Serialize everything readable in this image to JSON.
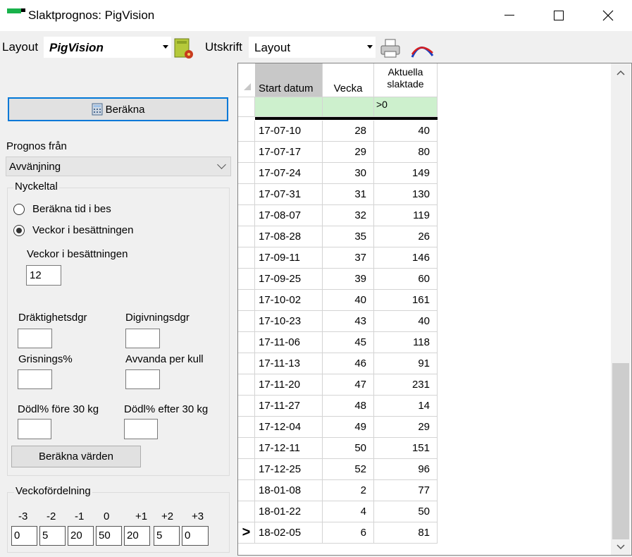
{
  "window": {
    "title": "Slaktprognos: PigVision",
    "minimize": "—",
    "maximize": "☐",
    "close": "✕"
  },
  "toolbar": {
    "layout_label": "Layout",
    "layout_value": "PigVision",
    "print_label": "Utskrift",
    "print_value": "Layout",
    "icons": [
      "layout-settings-icon",
      "printer-icon",
      "curve-chart-icon"
    ]
  },
  "panel": {
    "calc_button": "Beräkna",
    "prognos_label": "Prognos från",
    "prognos_value": "Avvänjning",
    "nyckeltal": {
      "legend": "Nyckeltal",
      "radio_calc": "Beräkna tid i bes",
      "radio_weeks": "Veckor i besättningen",
      "weeks_label": "Veckor i besättningen",
      "weeks_value": "12",
      "drakt_label": "Dräktighetsdgr",
      "digiv_label": "Digivningsdgr",
      "grisning_label": "Grisnings%",
      "avvanda_label": "Avvanda per kull",
      "dod_fore_label": "Dödl% före 30 kg",
      "dod_efter_label": "Dödl% efter 30 kg",
      "calc_values_button": "Beräkna värden"
    },
    "veckofordelning": {
      "legend": "Veckofördelning",
      "offsets": [
        "-3",
        "-2",
        "-1",
        "0",
        "+1",
        "+2",
        "+3"
      ],
      "values": [
        "0",
        "5",
        "20",
        "50",
        "20",
        "5",
        "0"
      ]
    }
  },
  "grid": {
    "headers": [
      "Start datum",
      "Vecka",
      "Aktuella slaktade"
    ],
    "filter": [
      "",
      "",
      ">0"
    ],
    "current_row_marker": ">",
    "rows": [
      [
        "17-07-10",
        "28",
        "40"
      ],
      [
        "17-07-17",
        "29",
        "80"
      ],
      [
        "17-07-24",
        "30",
        "149"
      ],
      [
        "17-07-31",
        "31",
        "130"
      ],
      [
        "17-08-07",
        "32",
        "119"
      ],
      [
        "17-08-28",
        "35",
        "26"
      ],
      [
        "17-09-11",
        "37",
        "146"
      ],
      [
        "17-09-25",
        "39",
        "60"
      ],
      [
        "17-10-02",
        "40",
        "161"
      ],
      [
        "17-10-23",
        "43",
        "40"
      ],
      [
        "17-11-06",
        "45",
        "118"
      ],
      [
        "17-11-13",
        "46",
        "91"
      ],
      [
        "17-11-20",
        "47",
        "231"
      ],
      [
        "17-11-27",
        "48",
        "14"
      ],
      [
        "17-12-04",
        "49",
        "29"
      ],
      [
        "17-12-11",
        "50",
        "151"
      ],
      [
        "17-12-25",
        "52",
        "96"
      ],
      [
        "18-01-08",
        "2",
        "77"
      ],
      [
        "18-01-22",
        "4",
        "50"
      ],
      [
        "18-02-05",
        "6",
        "81"
      ]
    ],
    "scroll_up": "^",
    "scroll_down": "⌄"
  }
}
